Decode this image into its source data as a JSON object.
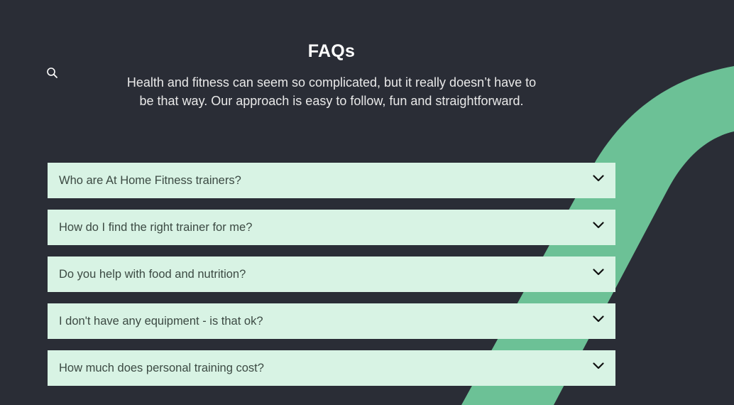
{
  "header": {
    "title": "FAQs",
    "subtitle": "Health and fitness can seem so complicated, but it really doesn’t have to be that way. Our approach is easy to follow, fun and straightforward."
  },
  "faqs": [
    {
      "question": "Who are At Home Fitness trainers?"
    },
    {
      "question": "How do I find the right trainer for me?"
    },
    {
      "question": "Do you help with food and nutrition?"
    },
    {
      "question": "I don't have any equipment - is that ok?"
    },
    {
      "question": "How much does personal training cost?"
    }
  ],
  "colors": {
    "background": "#2a2d36",
    "accent_swoosh": "#6cc196",
    "faq_item_bg": "#d8f3e4",
    "title_text": "#ffffff"
  },
  "icons": {
    "search": "search-icon",
    "expand": "chevron-down-icon"
  }
}
